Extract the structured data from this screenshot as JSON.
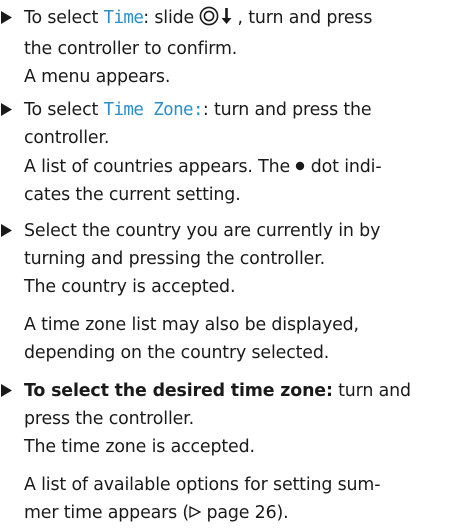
{
  "steps": [
    {
      "lines": [
        {
          "pre": "To select ",
          "display": "Time",
          "post": ": slide ",
          "post2": ", turn and press"
        },
        {
          "text": "the controller to confirm."
        },
        {
          "text": "A menu appears."
        }
      ]
    },
    {
      "lines": [
        {
          "pre": "To select ",
          "display": "Time Zone:",
          "post": ": turn and press the"
        },
        {
          "text": "controller."
        },
        {
          "text": "A list of countries appears. The ",
          "post": " dot indi-"
        },
        {
          "text": "cates the current setting."
        }
      ]
    },
    {
      "lines": [
        {
          "text": "Select the country you are currently in by"
        },
        {
          "text": "turning and pressing the controller."
        },
        {
          "text": "The country is accepted."
        },
        {
          "text": "A time zone list may also be displayed,"
        },
        {
          "text": "depending on the country selected."
        }
      ]
    },
    {
      "lines": [
        {
          "bold": "To select the desired time zone:",
          "post": " turn and"
        },
        {
          "text": "press the controller."
        },
        {
          "text": "The time zone is accepted."
        },
        {
          "text": "A list of available options for setting sum-"
        },
        {
          "text": "mer time appears (",
          "ref": "page 26",
          "post": ")."
        }
      ]
    }
  ]
}
